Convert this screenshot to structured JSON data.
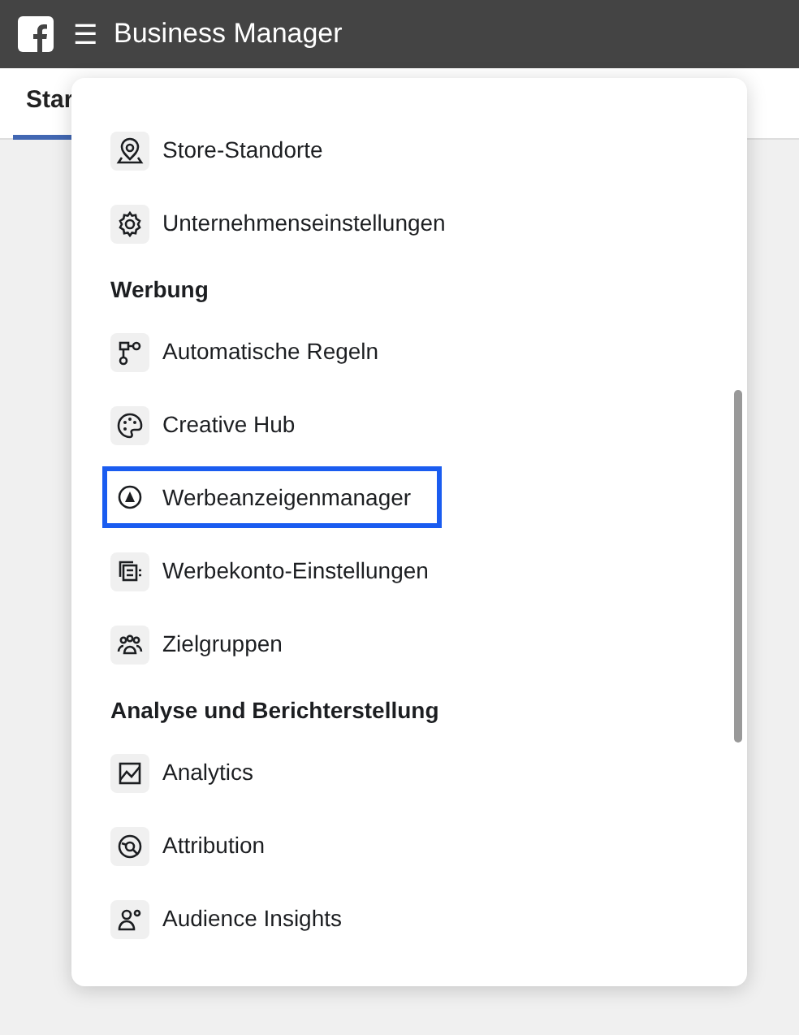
{
  "top_bar": {
    "title": "Business Manager",
    "menu_glyph": "☰"
  },
  "tabs": [
    {
      "label": "Star",
      "selected": true
    }
  ],
  "menu": {
    "entries": [
      {
        "kind": "item",
        "label": "Store-Standorte",
        "selected": false
      },
      {
        "kind": "item",
        "label": "Unternehmenseinstellungen",
        "selected": false
      },
      {
        "kind": "heading",
        "label": "Werbung"
      },
      {
        "kind": "item",
        "label": "Automatische Regeln",
        "selected": false
      },
      {
        "kind": "item",
        "label": "Creative Hub",
        "selected": false
      },
      {
        "kind": "item",
        "label": "Werbeanzeigenmanager",
        "selected": true
      },
      {
        "kind": "item",
        "label": "Werbekonto-Einstellungen",
        "selected": false
      },
      {
        "kind": "item",
        "label": "Zielgruppen",
        "selected": false
      },
      {
        "kind": "heading",
        "label": "Analyse und Berichterstellung"
      },
      {
        "kind": "item",
        "label": "Analytics",
        "selected": false
      },
      {
        "kind": "item",
        "label": "Attribution",
        "selected": false
      },
      {
        "kind": "item",
        "label": "Audience Insights",
        "selected": false
      }
    ]
  }
}
